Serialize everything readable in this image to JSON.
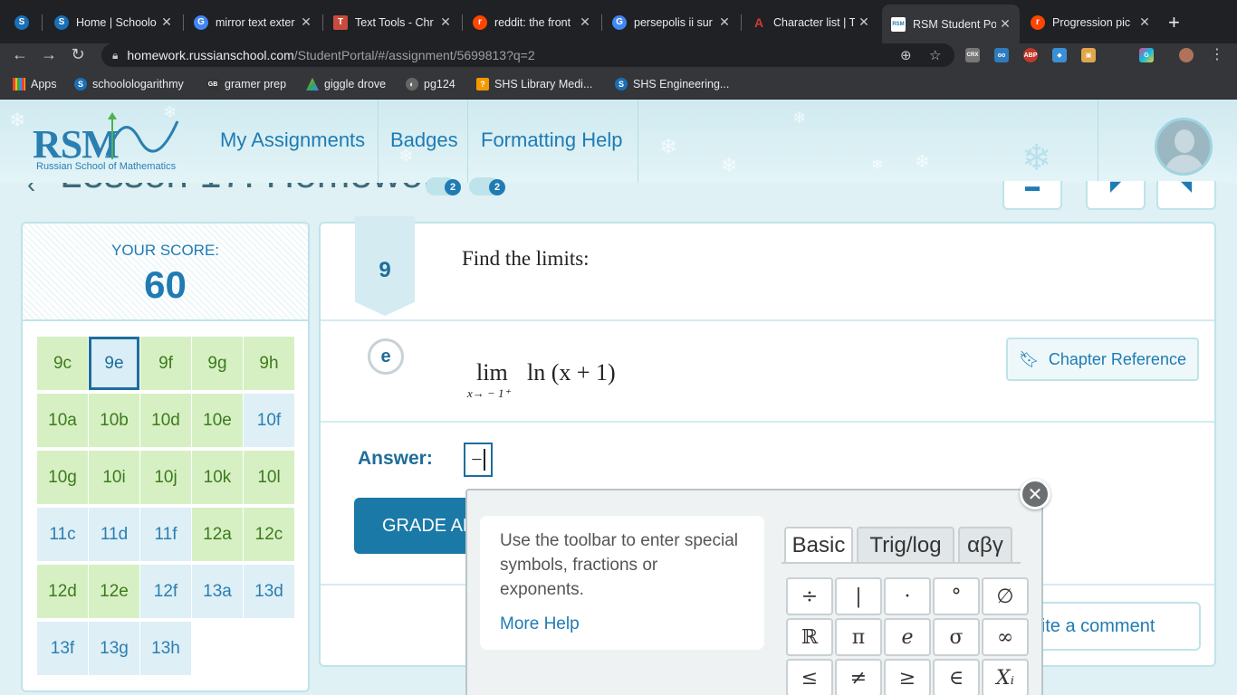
{
  "browser": {
    "tabs": [
      {
        "title": "Home | Schoolo",
        "favicon": "S",
        "color": "#1a6fb5"
      },
      {
        "title": "mirror text exter",
        "favicon": "G",
        "color": "#4285f4"
      },
      {
        "title": "Text Tools - Chr",
        "favicon": "T",
        "color": "#c94b3d"
      },
      {
        "title": "reddit: the front",
        "favicon": "r",
        "color": "#ff4500"
      },
      {
        "title": "persepolis ii sur",
        "favicon": "G",
        "color": "#4285f4"
      },
      {
        "title": "Character list | T",
        "favicon": "A",
        "color": "#d23a2e"
      },
      {
        "title": "RSM Student Po",
        "favicon": "RSM",
        "color": "#1f7bb3"
      },
      {
        "title": "Progression pic",
        "favicon": "r",
        "color": "#ff4500"
      }
    ],
    "url_host": "homework.russianschool.com",
    "url_path": "/StudentPortal/#/assignment/5699813?q=2",
    "bookmarks": [
      {
        "label": "Apps"
      },
      {
        "label": "schoolologarithmy"
      },
      {
        "label": "gramer prep"
      },
      {
        "label": "giggle drove"
      },
      {
        "label": "pg124"
      },
      {
        "label": "SHS Library Medi..."
      },
      {
        "label": "SHS Engineering..."
      }
    ],
    "extensions": [
      "CRX",
      "ABP"
    ]
  },
  "header": {
    "logo": "RSM",
    "logo_sub": "Russian School of Mathematics",
    "nav": [
      "My Assignments",
      "Badges",
      "Formatting Help"
    ]
  },
  "lesson": {
    "title": "Lesson 17: Homework",
    "badges": [
      "2",
      "2"
    ]
  },
  "score": {
    "label": "YOUR SCORE:",
    "value": "60",
    "cells": [
      {
        "label": "9c",
        "state": "green"
      },
      {
        "label": "9e",
        "state": "selected"
      },
      {
        "label": "9f",
        "state": "green"
      },
      {
        "label": "9g",
        "state": "green"
      },
      {
        "label": "9h",
        "state": "green"
      },
      {
        "label": "10a",
        "state": "green"
      },
      {
        "label": "10b",
        "state": "green"
      },
      {
        "label": "10d",
        "state": "green"
      },
      {
        "label": "10e",
        "state": "green"
      },
      {
        "label": "10f",
        "state": "blue"
      },
      {
        "label": "10g",
        "state": "green"
      },
      {
        "label": "10i",
        "state": "green"
      },
      {
        "label": "10j",
        "state": "green"
      },
      {
        "label": "10k",
        "state": "green"
      },
      {
        "label": "10l",
        "state": "green"
      },
      {
        "label": "11c",
        "state": "blue"
      },
      {
        "label": "11d",
        "state": "blue"
      },
      {
        "label": "11f",
        "state": "blue"
      },
      {
        "label": "12a",
        "state": "green"
      },
      {
        "label": "12c",
        "state": "green"
      },
      {
        "label": "12d",
        "state": "green"
      },
      {
        "label": "12e",
        "state": "green"
      },
      {
        "label": "12f",
        "state": "blue"
      },
      {
        "label": "13a",
        "state": "blue"
      },
      {
        "label": "13d",
        "state": "blue"
      },
      {
        "label": "13f",
        "state": "blue"
      },
      {
        "label": "13g",
        "state": "blue"
      },
      {
        "label": "13h",
        "state": "blue"
      }
    ]
  },
  "problem": {
    "number": "9",
    "prompt": "Find the limits:",
    "part": "e",
    "lim": "lim",
    "expression": "ln (x + 1)",
    "subscript": "x→ − 1⁺",
    "chapter_reference": "Chapter Reference",
    "answer_label": "Answer:",
    "answer_value": "−",
    "grade_button": "GRADE ANSWER",
    "comment_button": "Write a comment"
  },
  "toolbar_popup": {
    "help_text": "Use the toolbar to enter special symbols, fractions or exponents.",
    "more_help": "More Help",
    "tabs": [
      "Basic",
      "Trig/log",
      "αβγ"
    ],
    "active_tab": "Basic",
    "symbols_row1": [
      "÷",
      "|",
      "·",
      "°",
      "∅"
    ],
    "symbols_row2": [
      "ℝ",
      "π",
      "e",
      "σ",
      "∞"
    ],
    "symbols_row3": [
      "≤",
      "≠",
      "≥",
      "∈",
      "Xᵢ"
    ],
    "close": "✕"
  },
  "colors": {
    "accent": "#1f7bb3",
    "correct": "#d6f0c4",
    "pending": "#deeff6"
  }
}
